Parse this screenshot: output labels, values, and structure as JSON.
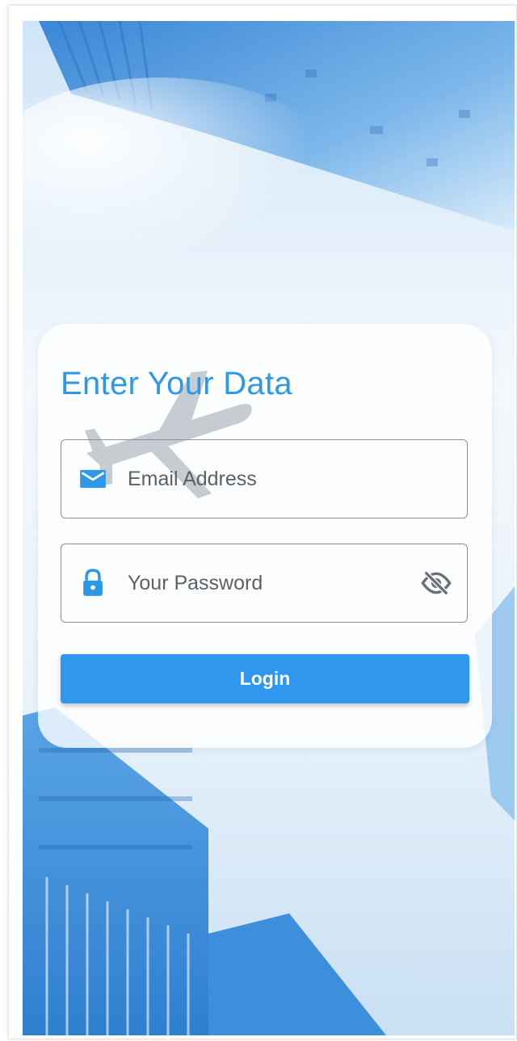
{
  "login_card": {
    "title": "Enter Your Data",
    "email_field": {
      "placeholder": "Email Address",
      "value": "",
      "icon": "email-icon"
    },
    "password_field": {
      "placeholder": "Your Password",
      "value": "",
      "icon": "lock-icon",
      "visibility_icon": "visibility-off-icon"
    },
    "login_button_label": "Login"
  },
  "colors": {
    "accent": "#2d98e6",
    "button": "#2f97ed",
    "field_border": "#8a8f95",
    "sky": "#dcecf9"
  }
}
